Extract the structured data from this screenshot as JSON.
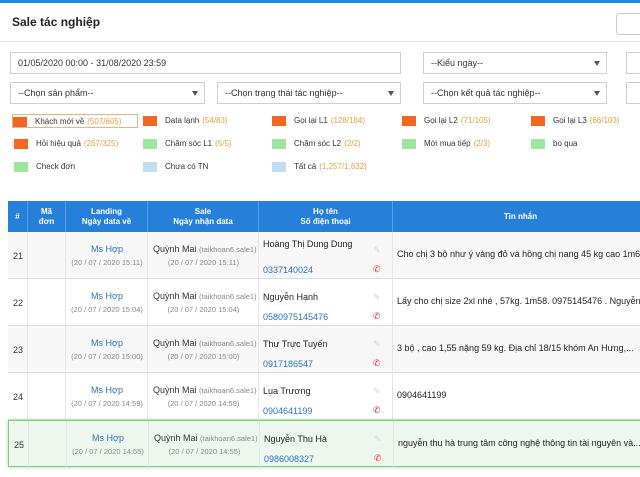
{
  "header": {
    "title": "Sale tác nghiệp"
  },
  "filters": {
    "date_range": "01/05/2020 00:00 - 31/08/2020 23:59",
    "date_type": "--Kiểu ngày--",
    "product": "--Chọn sản phẩm--",
    "status": "--Chọn trạng thái tác nghiệp--",
    "result": "--Chọn kết quả tác nghiệp--"
  },
  "legend": [
    {
      "label": "Khách mới về",
      "count": "(507/605)",
      "color": "#f26522",
      "active": true
    },
    {
      "label": "Data lạnh",
      "count": "(54/83)",
      "color": "#f26522"
    },
    {
      "label": "Gọi lại L1",
      "count": "(128/184)",
      "color": "#f26522"
    },
    {
      "label": "Gọi lại L2",
      "count": "(71/105)",
      "color": "#f26522"
    },
    {
      "label": "Gọi lại L3",
      "count": "(66/103)",
      "color": "#f26522"
    },
    {
      "label": "Hỏi hiệu quả",
      "count": "(267/325)",
      "color": "#f26522"
    },
    {
      "label": "Chăm sóc L1",
      "count": "(5/5)",
      "color": "#9be79b"
    },
    {
      "label": "Chăm sóc L2",
      "count": "(2/2)",
      "color": "#9be79b"
    },
    {
      "label": "Mới mua tiếp",
      "count": "(2/3)",
      "color": "#9be79b"
    },
    {
      "label": "bo qua",
      "count": "",
      "color": "#9be79b"
    },
    {
      "label": "Check đơn",
      "count": "",
      "color": "#9be79b"
    },
    {
      "label": "Chưa có TN",
      "count": "",
      "color": "#bfdff0"
    },
    {
      "label": "Tất cả",
      "count": "(1,257/1,632)",
      "color": "#bfdff0"
    }
  ],
  "table": {
    "headers": {
      "idx": "#",
      "ma": [
        "Mã",
        "đơn"
      ],
      "landing": [
        "Landing",
        "Ngày data về"
      ],
      "sale": [
        "Sale",
        "Ngày nhận data"
      ],
      "name": [
        "Họ tên",
        "Số điện thoại"
      ],
      "msg": "Tin nhắn"
    },
    "rows": [
      {
        "idx": "21",
        "landing": "Ms Hợp",
        "landing_date": "(20 / 07 / 2020 15:11)",
        "sale": "Quỳnh Mai",
        "sale_acc": "(taikhoan6.sale1)",
        "sale_date": "(20 / 07 / 2020 15:11)",
        "name": "Hoàng Thị Dung Dung",
        "phone": "0337140024",
        "msg": "Cho chị 3 bộ như ý vàng đỏ và hồng chị nang 45 kg cao 1m6..."
      },
      {
        "idx": "22",
        "landing": "Ms Hợp",
        "landing_date": "(20 / 07 / 2020 15:04)",
        "sale": "Quỳnh Mai",
        "sale_acc": "(taikhoan6.sale1)",
        "sale_date": "(20 / 07 / 2020 15:04)",
        "name": "Nguyễn Hạnh",
        "phone": "0580975145476",
        "msg": "Lấy cho chị size 2xl nhé , 57kg. 1m58. 0975145476 . Nguyễn..."
      },
      {
        "idx": "23",
        "landing": "Ms Hợp",
        "landing_date": "(20 / 07 / 2020 15:00)",
        "sale": "Quỳnh Mai",
        "sale_acc": "(taikhoan6.sale1)",
        "sale_date": "(20 / 07 / 2020 15:00)",
        "name": "Thư Trực Tuyến",
        "phone": "0917186547",
        "msg": "3 bộ , cao 1,55 nặng 59 kg. Địa chỉ 18/15 khóm An Hưng,..."
      },
      {
        "idx": "24",
        "landing": "Ms Hợp",
        "landing_date": "(20 / 07 / 2020 14:59)",
        "sale": "Quỳnh Mai",
        "sale_acc": "(taikhoan6.sale1)",
        "sale_date": "(20 / 07 / 2020 14:59)",
        "name": "Lụa Trương",
        "phone": "0904641199",
        "msg": "0904641199"
      },
      {
        "idx": "25",
        "landing": "Ms Hợp",
        "landing_date": "(20 / 07 / 2020 14:55)",
        "sale": "Quỳnh Mai",
        "sale_acc": "(taikhoan6.sale1)",
        "sale_date": "(20 / 07 / 2020 14:55)",
        "name": "Nguyễn Thu Hà",
        "phone": "0986008327",
        "msg": "nguyễn thu hà trung tâm công nghệ thông tin tài nguyên và...",
        "selected": true
      }
    ]
  },
  "icons": {
    "edit": "edit-icon",
    "call": "phone-icon"
  }
}
